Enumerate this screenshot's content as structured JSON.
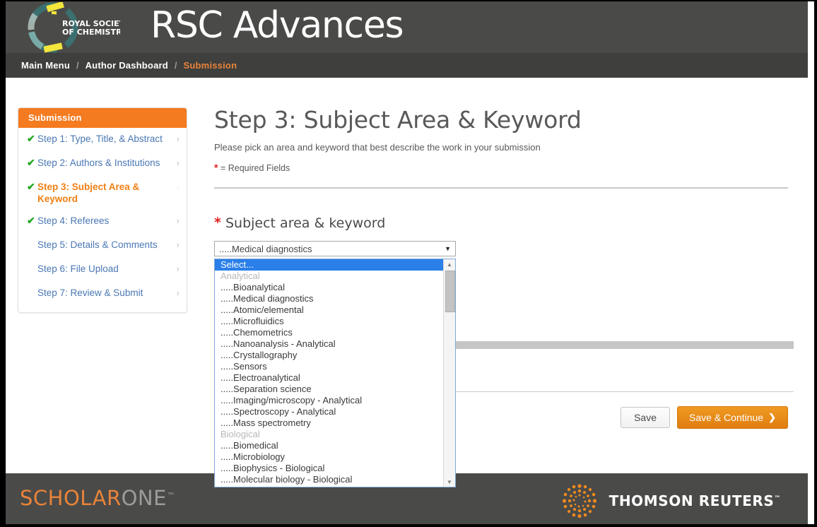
{
  "header": {
    "journal_title": "RSC Advances",
    "logo_alt": "Royal Society of Chemistry",
    "logo_line1": "ROYAL SOCIETY",
    "logo_line2": "OF CHEMISTRY"
  },
  "breadcrumb": {
    "items": [
      {
        "label": "Main Menu",
        "current": false
      },
      {
        "label": "Author Dashboard",
        "current": false
      },
      {
        "label": "Submission",
        "current": true
      }
    ],
    "separator": "/"
  },
  "sidebar": {
    "title": "Submission",
    "steps": [
      {
        "label": "Step 1: Type, Title, & Abstract",
        "complete": true,
        "active": false
      },
      {
        "label": "Step 2: Authors & Institutions",
        "complete": true,
        "active": false
      },
      {
        "label": "Step 3: Subject Area & Keyword",
        "complete": true,
        "active": true
      },
      {
        "label": "Step 4: Referees",
        "complete": true,
        "active": false
      },
      {
        "label": "Step 5: Details & Comments",
        "complete": false,
        "active": false
      },
      {
        "label": "Step 6: File Upload",
        "complete": false,
        "active": false
      },
      {
        "label": "Step 7: Review & Submit",
        "complete": false,
        "active": false
      }
    ],
    "check_glyph": "✔",
    "chevron_glyph": "›"
  },
  "main": {
    "page_title": "Step 3: Subject Area & Keyword",
    "subtitle": "Please pick an area and keyword that best describe the work in your submission",
    "required_star": "*",
    "required_note": "= Required Fields",
    "field_label": "Subject area & keyword",
    "select": {
      "value": ".....Medical diagnostics",
      "arrow_glyph": "▼"
    }
  },
  "dropdown": {
    "scroll_up_glyph": "▲",
    "scroll_down_glyph": "▼",
    "options": [
      {
        "label": "Select...",
        "group": false,
        "selected": true
      },
      {
        "label": "Analytical",
        "group": true,
        "selected": false
      },
      {
        "label": ".....Bioanalytical",
        "group": false,
        "selected": false
      },
      {
        "label": ".....Medical diagnostics",
        "group": false,
        "selected": false
      },
      {
        "label": ".....Atomic/elemental",
        "group": false,
        "selected": false
      },
      {
        "label": ".....Microfluidics",
        "group": false,
        "selected": false
      },
      {
        "label": ".....Chemometrics",
        "group": false,
        "selected": false
      },
      {
        "label": ".....Nanoanalysis - Analytical",
        "group": false,
        "selected": false
      },
      {
        "label": ".....Crystallography",
        "group": false,
        "selected": false
      },
      {
        "label": ".....Sensors",
        "group": false,
        "selected": false
      },
      {
        "label": ".....Electroanalytical",
        "group": false,
        "selected": false
      },
      {
        "label": ".....Separation science",
        "group": false,
        "selected": false
      },
      {
        "label": ".....Imaging/microscopy - Analytical",
        "group": false,
        "selected": false
      },
      {
        "label": ".....Spectroscopy - Analytical",
        "group": false,
        "selected": false
      },
      {
        "label": ".....Mass spectrometry",
        "group": false,
        "selected": false
      },
      {
        "label": "Biological",
        "group": true,
        "selected": false
      },
      {
        "label": ".....Biomedical",
        "group": false,
        "selected": false
      },
      {
        "label": ".....Microbiology",
        "group": false,
        "selected": false
      },
      {
        "label": ".....Biophysics - Biological",
        "group": false,
        "selected": false
      },
      {
        "label": ".....Molecular biology - Biological",
        "group": false,
        "selected": false
      }
    ]
  },
  "actions": {
    "save_label": "Save",
    "save_continue_label": "Save & Continue",
    "save_continue_chevron": "❯"
  },
  "footer": {
    "scholarone_part1": "SCHOLAR",
    "scholarone_part2": "ONE",
    "scholarone_tm": "™",
    "thomson_reuters": "THOMSON REUTERS",
    "thomson_tm": "™"
  },
  "colors": {
    "brand_orange": "#f47b20",
    "header_grey": "#4a4a48",
    "link_blue": "#4a77b4",
    "check_green": "#22aa22",
    "required_red": "#e02020",
    "select_highlight": "#2a7fe8"
  }
}
